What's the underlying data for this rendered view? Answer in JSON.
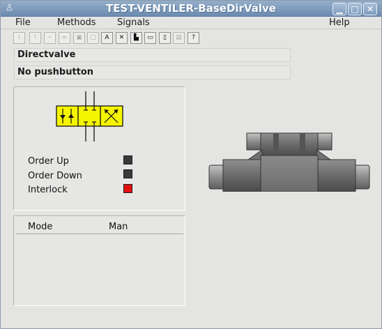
{
  "window": {
    "title": "TEST-VENTILER-BaseDirValve",
    "app_icon": "ventilator-app-icon",
    "controls": [
      "minimize-icon",
      "maximize-icon",
      "close-icon"
    ]
  },
  "menu": {
    "file": "File",
    "methods": "Methods",
    "signals": "Signals",
    "help": "Help"
  },
  "toolbar": {
    "buttons": [
      {
        "icon": "info-icon",
        "glyph": "i",
        "enabled": false
      },
      {
        "icon": "alarm-icon",
        "glyph": "!",
        "enabled": false
      },
      {
        "icon": "trend-icon",
        "glyph": "~",
        "enabled": false
      },
      {
        "icon": "fast-curve-icon",
        "glyph": "≈",
        "enabled": false
      },
      {
        "icon": "object-graph-icon",
        "glyph": "▣",
        "enabled": false
      },
      {
        "icon": "history-icon",
        "glyph": "▢",
        "enabled": false
      },
      {
        "icon": "navigator-icon",
        "glyph": "A",
        "enabled": true
      },
      {
        "icon": "crossref-icon",
        "glyph": "✕",
        "enabled": true
      },
      {
        "icon": "help-class-icon",
        "glyph": "▙",
        "enabled": true
      },
      {
        "icon": "open-plc-icon",
        "glyph": "▭",
        "enabled": true
      },
      {
        "icon": "block-icon",
        "glyph": "▯",
        "enabled": true
      },
      {
        "icon": "photo-icon",
        "glyph": "▤",
        "enabled": false
      },
      {
        "icon": "help-icon",
        "glyph": "?",
        "enabled": true
      }
    ]
  },
  "info": {
    "description": "Directvalve",
    "specification": "No pushbutton"
  },
  "signals": {
    "order_up": "Order Up",
    "order_down": "Order Down",
    "interlock": "Interlock",
    "colors": {
      "order_up": "#3a3a3a",
      "order_down": "#3a3a3a",
      "interlock": "#e01010"
    }
  },
  "mode": {
    "label": "Mode",
    "value": "Man"
  },
  "colors": {
    "valve_symbol": "#f5f500",
    "valve_body": "#6a6a6a"
  }
}
